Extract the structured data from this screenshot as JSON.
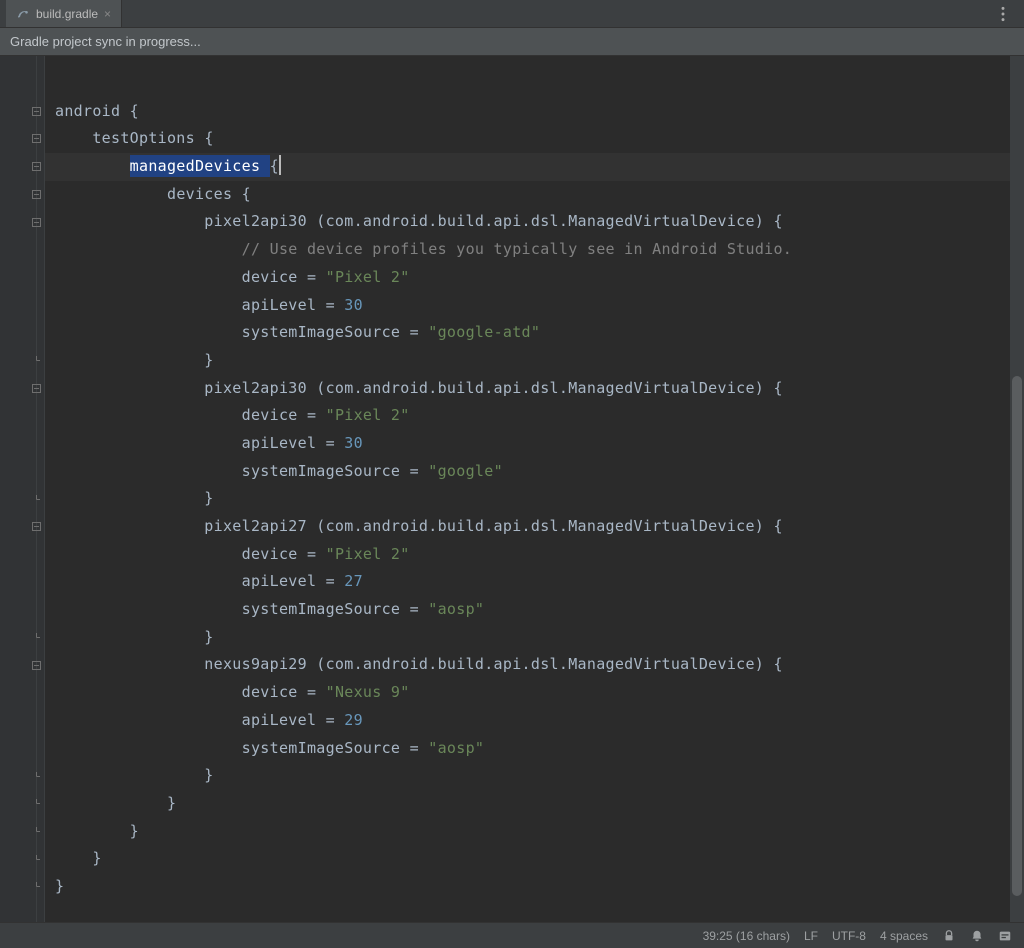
{
  "tab": {
    "filename": "build.gradle",
    "close_tooltip": "Close"
  },
  "banner": {
    "text": "Gradle project sync in progress..."
  },
  "code": {
    "lines": [
      {
        "t": "plain",
        "indent": 0,
        "parts": []
      },
      {
        "t": "block-open",
        "indent": 0,
        "parts": [
          {
            "c": "plain",
            "v": "android "
          },
          {
            "c": "plain",
            "v": "{"
          }
        ]
      },
      {
        "t": "block-open",
        "indent": 1,
        "parts": [
          {
            "c": "plain",
            "v": "testOptions "
          },
          {
            "c": "plain",
            "v": "{"
          }
        ]
      },
      {
        "t": "block-open hl sel",
        "indent": 2,
        "parts": [
          {
            "c": "sel",
            "v": "managedDevices "
          },
          {
            "c": "plain",
            "v": "{"
          },
          {
            "c": "caret",
            "v": ""
          }
        ]
      },
      {
        "t": "block-open",
        "indent": 3,
        "parts": [
          {
            "c": "plain",
            "v": "devices "
          },
          {
            "c": "plain",
            "v": "{"
          }
        ]
      },
      {
        "t": "block-open",
        "indent": 4,
        "parts": [
          {
            "c": "plain",
            "v": "pixel2api30 (com.android.build.api.dsl.ManagedVirtualDevice) {"
          }
        ]
      },
      {
        "t": "comment",
        "indent": 5,
        "parts": [
          {
            "c": "cm",
            "v": "// Use device profiles you typically see in Android Studio."
          }
        ]
      },
      {
        "t": "stmt",
        "indent": 5,
        "parts": [
          {
            "c": "plain",
            "v": "device = "
          },
          {
            "c": "str",
            "v": "\"Pixel 2\""
          }
        ]
      },
      {
        "t": "stmt",
        "indent": 5,
        "parts": [
          {
            "c": "plain",
            "v": "apiLevel = "
          },
          {
            "c": "num",
            "v": "30"
          }
        ]
      },
      {
        "t": "stmt",
        "indent": 5,
        "parts": [
          {
            "c": "plain",
            "v": "systemImageSource = "
          },
          {
            "c": "str",
            "v": "\"google-atd\""
          }
        ]
      },
      {
        "t": "block-close",
        "indent": 4,
        "parts": [
          {
            "c": "plain",
            "v": "}"
          }
        ]
      },
      {
        "t": "block-open",
        "indent": 4,
        "parts": [
          {
            "c": "plain",
            "v": "pixel2api30 (com.android.build.api.dsl.ManagedVirtualDevice) {"
          }
        ]
      },
      {
        "t": "stmt",
        "indent": 5,
        "parts": [
          {
            "c": "plain",
            "v": "device = "
          },
          {
            "c": "str",
            "v": "\"Pixel 2\""
          }
        ]
      },
      {
        "t": "stmt",
        "indent": 5,
        "parts": [
          {
            "c": "plain",
            "v": "apiLevel = "
          },
          {
            "c": "num",
            "v": "30"
          }
        ]
      },
      {
        "t": "stmt",
        "indent": 5,
        "parts": [
          {
            "c": "plain",
            "v": "systemImageSource = "
          },
          {
            "c": "str",
            "v": "\"google\""
          }
        ]
      },
      {
        "t": "block-close",
        "indent": 4,
        "parts": [
          {
            "c": "plain",
            "v": "}"
          }
        ]
      },
      {
        "t": "block-open",
        "indent": 4,
        "parts": [
          {
            "c": "plain",
            "v": "pixel2api27 (com.android.build.api.dsl.ManagedVirtualDevice) {"
          }
        ]
      },
      {
        "t": "stmt",
        "indent": 5,
        "parts": [
          {
            "c": "plain",
            "v": "device = "
          },
          {
            "c": "str",
            "v": "\"Pixel 2\""
          }
        ]
      },
      {
        "t": "stmt",
        "indent": 5,
        "parts": [
          {
            "c": "plain",
            "v": "apiLevel = "
          },
          {
            "c": "num",
            "v": "27"
          }
        ]
      },
      {
        "t": "stmt",
        "indent": 5,
        "parts": [
          {
            "c": "plain",
            "v": "systemImageSource = "
          },
          {
            "c": "str",
            "v": "\"aosp\""
          }
        ]
      },
      {
        "t": "block-close",
        "indent": 4,
        "parts": [
          {
            "c": "plain",
            "v": "}"
          }
        ]
      },
      {
        "t": "block-open",
        "indent": 4,
        "parts": [
          {
            "c": "plain",
            "v": "nexus9api29 (com.android.build.api.dsl.ManagedVirtualDevice) {"
          }
        ]
      },
      {
        "t": "stmt",
        "indent": 5,
        "parts": [
          {
            "c": "plain",
            "v": "device = "
          },
          {
            "c": "str",
            "v": "\"Nexus 9\""
          }
        ]
      },
      {
        "t": "stmt",
        "indent": 5,
        "parts": [
          {
            "c": "plain",
            "v": "apiLevel = "
          },
          {
            "c": "num",
            "v": "29"
          }
        ]
      },
      {
        "t": "stmt",
        "indent": 5,
        "parts": [
          {
            "c": "plain",
            "v": "systemImageSource = "
          },
          {
            "c": "str",
            "v": "\"aosp\""
          }
        ]
      },
      {
        "t": "block-close",
        "indent": 4,
        "parts": [
          {
            "c": "plain",
            "v": "}"
          }
        ]
      },
      {
        "t": "block-close",
        "indent": 3,
        "parts": [
          {
            "c": "plain",
            "v": "}"
          }
        ]
      },
      {
        "t": "block-close",
        "indent": 2,
        "parts": [
          {
            "c": "plain",
            "v": "}"
          }
        ]
      },
      {
        "t": "block-close",
        "indent": 1,
        "parts": [
          {
            "c": "plain",
            "v": "}"
          }
        ]
      },
      {
        "t": "block-close",
        "indent": 0,
        "parts": [
          {
            "c": "plain",
            "v": "}"
          }
        ]
      }
    ],
    "indent_unit": "    "
  },
  "status": {
    "position": "39:25 (16 chars)",
    "line_sep": "LF",
    "encoding": "UTF-8",
    "indent": "4 spaces"
  },
  "icons": {
    "gradle": "gradle-icon",
    "kebab": "kebab-icon",
    "lock": "lock-icon",
    "bell": "bell-icon",
    "event": "event-icon"
  }
}
